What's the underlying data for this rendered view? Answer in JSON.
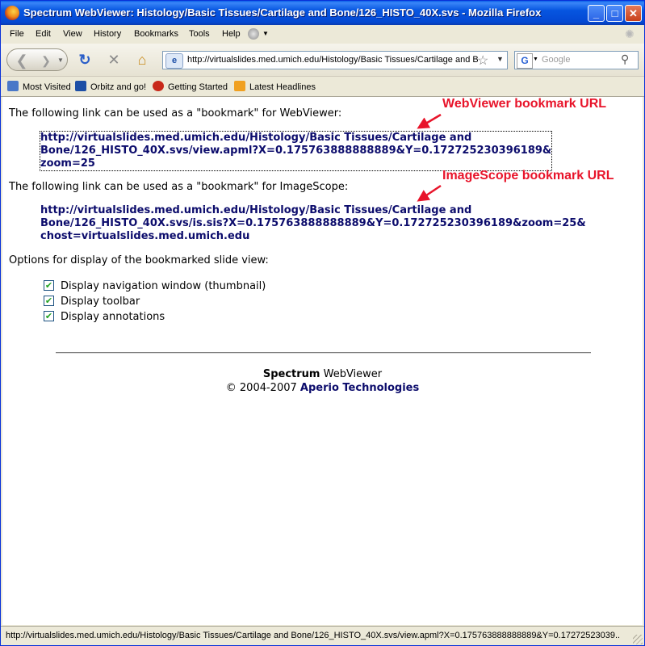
{
  "window": {
    "title": "Spectrum WebViewer: Histology/Basic Tissues/Cartilage and Bone/126_HISTO_40X.svs - Mozilla Firefox",
    "minimize": "_",
    "maximize": "□",
    "close": "✕"
  },
  "menu": [
    "File",
    "Edit",
    "View",
    "History",
    "Bookmarks",
    "Tools",
    "Help"
  ],
  "toolbar": {
    "url": "http://virtualslides.med.umich.edu/Histology/Basic Tissues/Cartilage and B",
    "search_placeholder": "Google",
    "search_engine": "G"
  },
  "bookmarks": [
    {
      "label": "Most Visited",
      "icon": "bookmarks-icon",
      "color": "#4a78c8"
    },
    {
      "label": "Orbitz and go!",
      "icon": "orbitz-icon",
      "color": "#1d4fa6"
    },
    {
      "label": "Getting Started",
      "icon": "firefox-icon",
      "color": "#c8281a"
    },
    {
      "label": "Latest Headlines",
      "icon": "rss-icon",
      "color": "#f0a020"
    }
  ],
  "page": {
    "webviewer_intro": "The following link can be used as a \"bookmark\" for WebViewer:",
    "webviewer_link": [
      "http://virtualslides.med.umich.edu/Histology/Basic Tissues/Cartilage and",
      "Bone/126_HISTO_40X.svs/view.apml?X=0.175763888888889&Y=0.172725230396189&",
      "zoom=25"
    ],
    "imagescope_intro": "The following link can be used as a \"bookmark\" for ImageScope:",
    "imagescope_link": [
      "http://virtualslides.med.umich.edu/Histology/Basic Tissues/Cartilage and",
      "Bone/126_HISTO_40X.svs/is.sis?X=0.175763888888889&Y=0.172725230396189&zoom=25&",
      "chost=virtualslides.med.umich.edu"
    ],
    "options_intro": "Options for display of the bookmarked slide view:",
    "options": [
      {
        "label": "Display navigation window (thumbnail)",
        "checked": true
      },
      {
        "label": "Display toolbar",
        "checked": true
      },
      {
        "label": "Display annotations",
        "checked": true
      }
    ],
    "annotations": {
      "webviewer": "WebViewer bookmark URL",
      "imagescope": "ImageScope bookmark URL",
      "color": "#e8142a"
    },
    "footer": {
      "brand_bold": "Spectrum",
      "brand_rest": " WebViewer",
      "copyright": "© 2004-2007 ",
      "company": "Aperio Technologies"
    }
  },
  "status": "http://virtualslides.med.umich.edu/Histology/Basic Tissues/Cartilage and Bone/126_HISTO_40X.svs/view.apml?X=0.175763888888889&Y=0.17272523039..."
}
